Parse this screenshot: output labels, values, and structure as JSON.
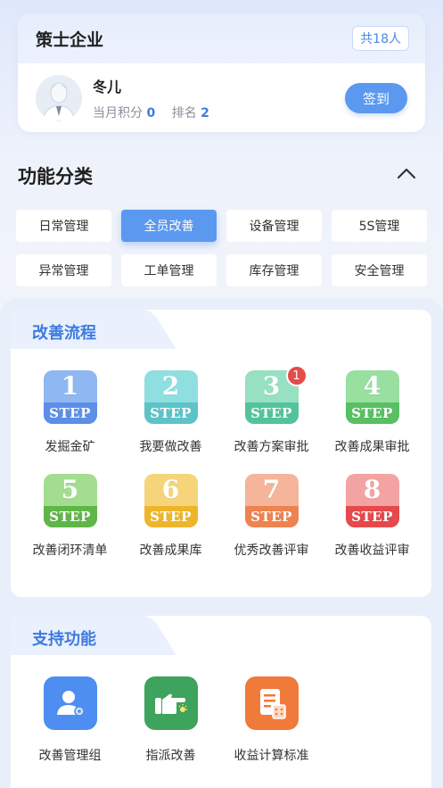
{
  "company": {
    "name": "策士企业",
    "member_count": "共18人"
  },
  "user": {
    "name": "冬儿",
    "points_label": "当月积分",
    "points_value": "0",
    "rank_label": "排名",
    "rank_value": "2",
    "checkin_label": "签到"
  },
  "categories": {
    "title": "功能分类",
    "items": [
      {
        "label": "日常管理",
        "active": false
      },
      {
        "label": "全员改善",
        "active": true
      },
      {
        "label": "设备管理",
        "active": false
      },
      {
        "label": "5S管理",
        "active": false
      },
      {
        "label": "异常管理",
        "active": false
      },
      {
        "label": "工单管理",
        "active": false
      },
      {
        "label": "库存管理",
        "active": false
      },
      {
        "label": "安全管理",
        "active": false
      }
    ]
  },
  "improvement_flow": {
    "title": "改善流程",
    "step_word": "STEP",
    "steps": [
      {
        "num": "1",
        "label": "发掘金矿",
        "color": "#8fb7f2",
        "band": "#5b8fe8"
      },
      {
        "num": "2",
        "label": "我要做改善",
        "color": "#8fdfe0",
        "band": "#5ec3c7"
      },
      {
        "num": "3",
        "label": "改善方案审批",
        "color": "#97e0c2",
        "band": "#53c49a",
        "badge": "1"
      },
      {
        "num": "4",
        "label": "改善成果审批",
        "color": "#98dfa0",
        "band": "#58bf62"
      },
      {
        "num": "5",
        "label": "改善闭环清单",
        "color": "#a3dd8f",
        "band": "#5fb548"
      },
      {
        "num": "6",
        "label": "改善成果库",
        "color": "#f6d57a",
        "band": "#eeb52c"
      },
      {
        "num": "7",
        "label": "优秀改善评审",
        "color": "#f4b59a",
        "band": "#ec8350"
      },
      {
        "num": "8",
        "label": "改善收益评审",
        "color": "#f4a3a3",
        "band": "#e4494b"
      }
    ]
  },
  "support": {
    "title": "支持功能",
    "items": [
      {
        "label": "改善管理组",
        "icon": "user-group-icon",
        "color": "#4d8ef0"
      },
      {
        "label": "指派改善",
        "icon": "pointing-hand-icon",
        "color": "#3ea35c"
      },
      {
        "label": "收益计算标准",
        "icon": "document-calculator-icon",
        "color": "#f07a3a"
      }
    ]
  }
}
